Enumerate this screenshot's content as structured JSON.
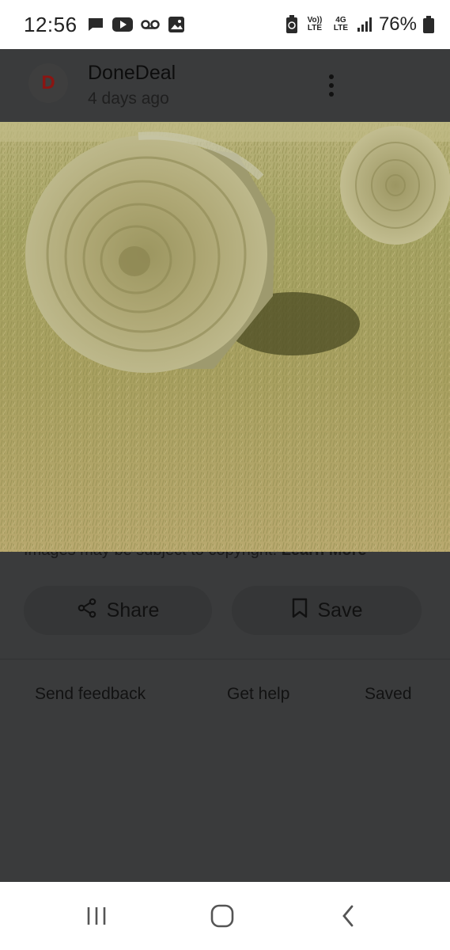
{
  "status_bar": {
    "time": "12:56",
    "battery": "76%",
    "lte_label": "Vo)) LTE",
    "net_label": "4G LTE",
    "icons": [
      "chat-icon",
      "youtube-icon",
      "voicemail-icon",
      "gallery-icon",
      "battery-saver-icon",
      "signal-icon",
      "battery-icon"
    ]
  },
  "header": {
    "logo_letter": "D",
    "site_name": "DoneDeal",
    "time_ago": "4 days ago"
  },
  "image": {
    "subject": "hay-bales-photo"
  },
  "copyright": {
    "text": "Images may be subject to copyright.",
    "link": "Learn More"
  },
  "actions": {
    "share_label": "Share",
    "save_label": "Save"
  },
  "footer": {
    "send_feedback": "Send feedback",
    "get_help": "Get help",
    "saved": "Saved"
  },
  "colors": {
    "overlay": "#3a3b3c",
    "logo_red": "#8a1512",
    "status_bg": "#ffffff"
  }
}
